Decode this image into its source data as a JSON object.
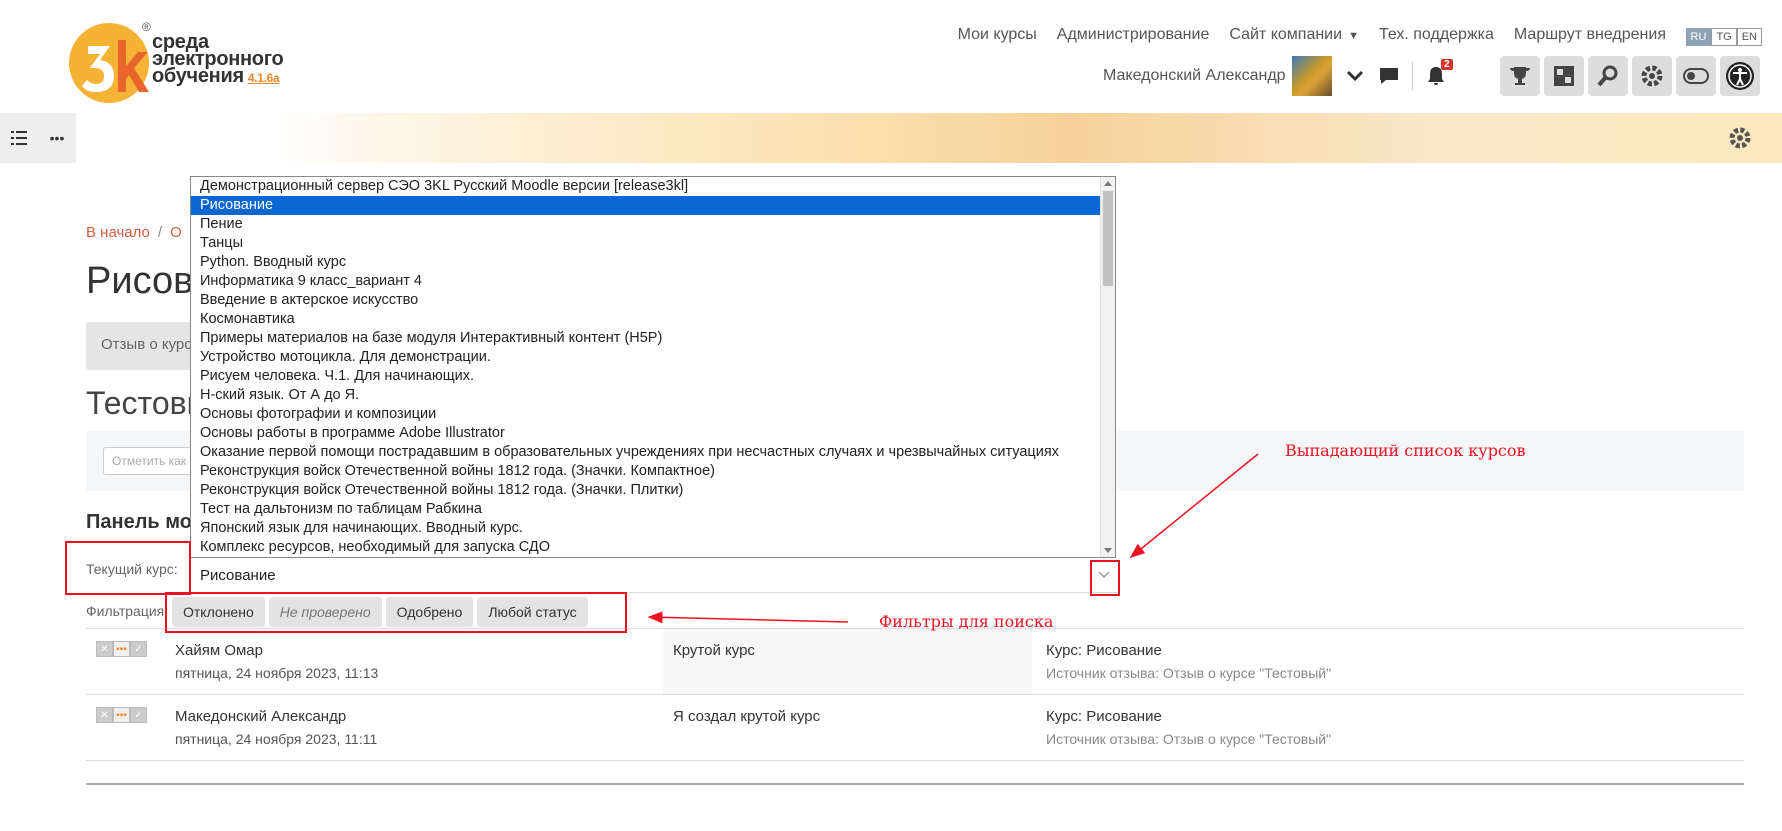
{
  "header": {
    "logo_text_line1": "среда",
    "logo_text_line2": "электронного",
    "logo_text_line3": "обучения",
    "logo_version": "4.1.6а",
    "logo_reg": "®",
    "nav": [
      "Мои курсы",
      "Администрирование",
      "Сайт компании",
      "Тех. поддержка",
      "Маршрут внедрения"
    ],
    "languages": [
      "RU",
      "TG",
      "EN"
    ],
    "active_language": "RU",
    "user_name": "Македонский Александр",
    "notifications_count": "2"
  },
  "breadcrumb": {
    "home": "В начало",
    "separator": "/",
    "next": "О"
  },
  "page_title": "Рисов",
  "feedback_tab": "Отзыв о курс",
  "subtitle": "Тестовы",
  "filter_placeholder": "Отметить как",
  "panel_heading": "Панель мод",
  "current_course_label": "Текущий курс:",
  "current_course_value": "Рисование",
  "dropdown_items": [
    "Демонстрационный сервер СЭО 3KL Русский Moodle версии [release3kl]",
    "Рисование",
    "Пение",
    "Танцы",
    "Python. Вводный курс",
    "Информатика 9 класс_вариант 4",
    "Введение в актерское искусство",
    "Космонавтика",
    "Примеры материалов на базе модуля Интерактивный контент (H5P)",
    "Устройство мотоцикла. Для демонстрации.",
    "Рисуем человека. Ч.1. Для начинающих.",
    "Н-ский язык. От А до Я.",
    "Основы фотографии и композиции",
    "Основы работы в программе Adobe Illustrator",
    "Оказание первой помощи пострадавшим в образовательных учреждениях при несчастных случаях и чрезвычайных ситуациях",
    "Реконструкция войск Отечественной войны 1812 года. (Значки. Компактное)",
    "Реконструкция войск Отечественной войны 1812 года. (Значки. Плитки)",
    "Тест на дальтонизм по таблицам Рабкина",
    "Японский язык для начинающих. Вводный курс.",
    "Комплекс ресурсов, необходимый для запуска СДО"
  ],
  "selected_index": 1,
  "filter_label": "Фильтрация:",
  "filter_buttons": [
    "Отклонено",
    "Не проверено",
    "Одобрено",
    "Любой статус"
  ],
  "reviews": [
    {
      "author": "Хайям Омар",
      "date": "пятница, 24 ноября 2023, 11:13",
      "comment": "Крутой курс",
      "course": "Курс: Рисование",
      "source": "Источник отзыва: Отзыв о курсе \"Тестовый\""
    },
    {
      "author": "Македонский Александр",
      "date": "пятница, 24 ноября 2023, 11:11",
      "comment": "Я создал крутой курс",
      "course": "Курс: Рисование",
      "source": "Источник отзыва: Отзыв о курсе \"Тестовый\""
    }
  ],
  "annotations": {
    "dropdown_note": "Выпадающий список курсов",
    "filters_note": "Фильтры для поиска"
  },
  "colors": {
    "accent": "#d65c3c",
    "selected": "#0a66d1",
    "annotation": "#ee1122"
  }
}
